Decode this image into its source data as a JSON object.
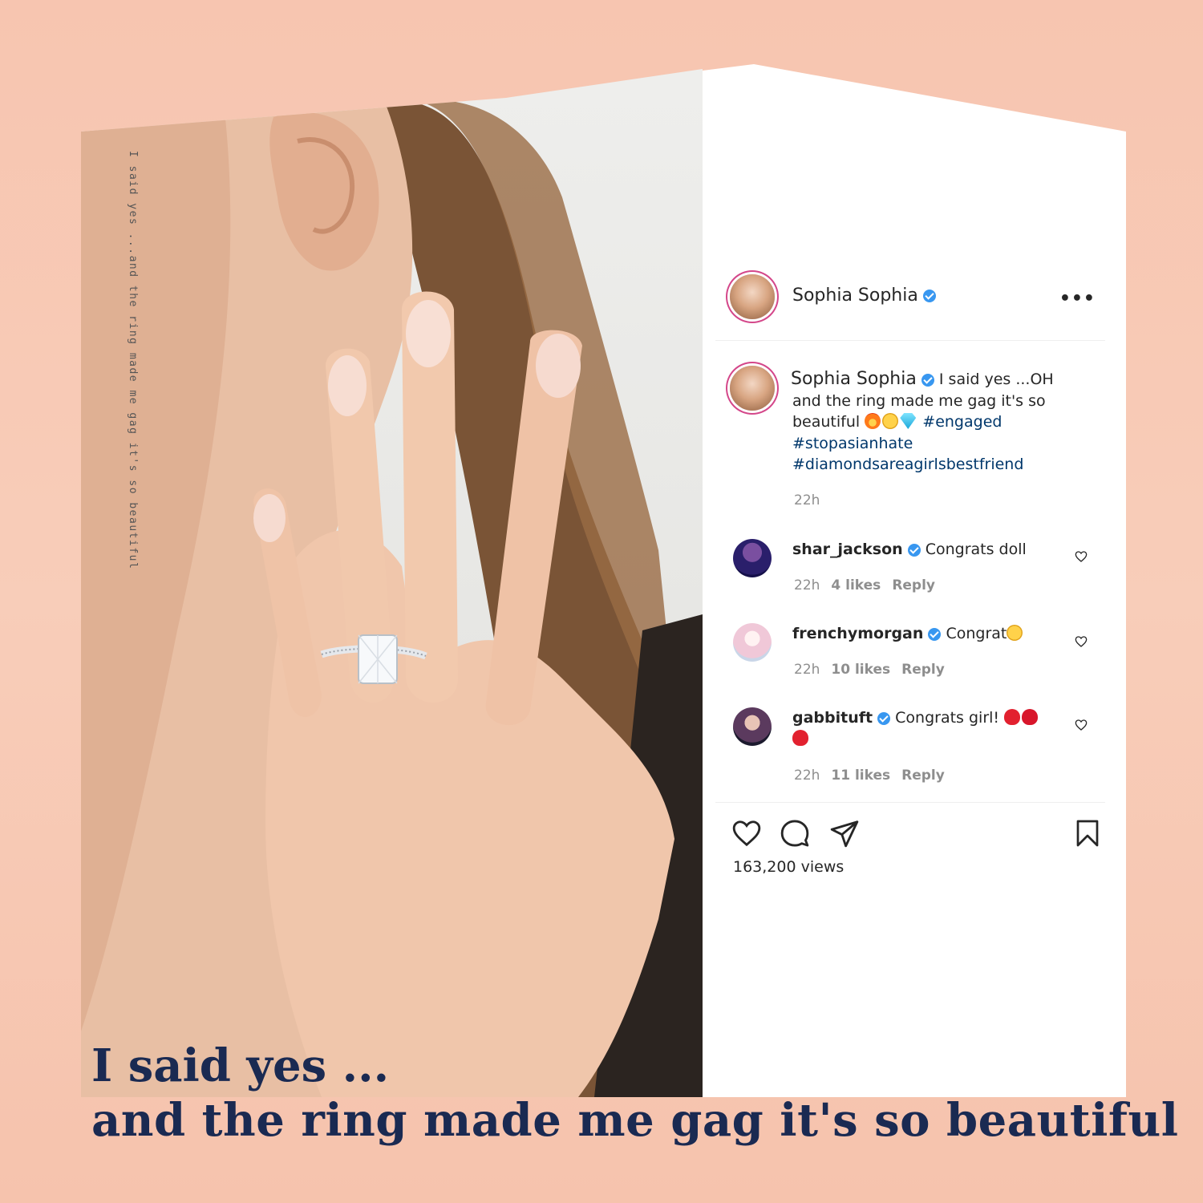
{
  "vertical_caption": "I said yes ...and the ring made me gag it's so beautiful",
  "post": {
    "author": "Sophia Sophia",
    "caption_author": "Sophia Sophia",
    "caption_text": " I said yes ...OH and the ring made me gag it's so beautiful",
    "hashtags": [
      "#engaged",
      "#stopasianhate",
      "#diamondsareagirlsbestfriend"
    ],
    "timestamp": "22h",
    "more_label": "•••",
    "views": "163,200 views"
  },
  "comments": [
    {
      "user": "shar_jackson",
      "text": "Congrats doll",
      "time": "22h",
      "likes": "4 likes",
      "reply": "Reply"
    },
    {
      "user": "frenchymorgan",
      "text": "Congrat",
      "time": "22h",
      "likes": "10 likes",
      "reply": "Reply"
    },
    {
      "user": "gabbituft",
      "text": "Congrats girl!",
      "time": "22h",
      "likes": "11 likes",
      "reply": "Reply"
    }
  ],
  "headline": {
    "line1": "I said yes ...",
    "line2": "and the ring made me gag it's so beautiful"
  },
  "colors": {
    "background": "#f8c8b4",
    "headline": "#1a2a52",
    "hashtag": "#00376b",
    "verified": "#3897f0"
  },
  "icons": [
    "verified-badge-icon",
    "more-options-icon",
    "heart-icon",
    "comment-icon",
    "share-icon",
    "bookmark-icon",
    "fire-emoji",
    "heart-eyes-emoji",
    "diamond-emoji",
    "red-heart-emoji"
  ]
}
